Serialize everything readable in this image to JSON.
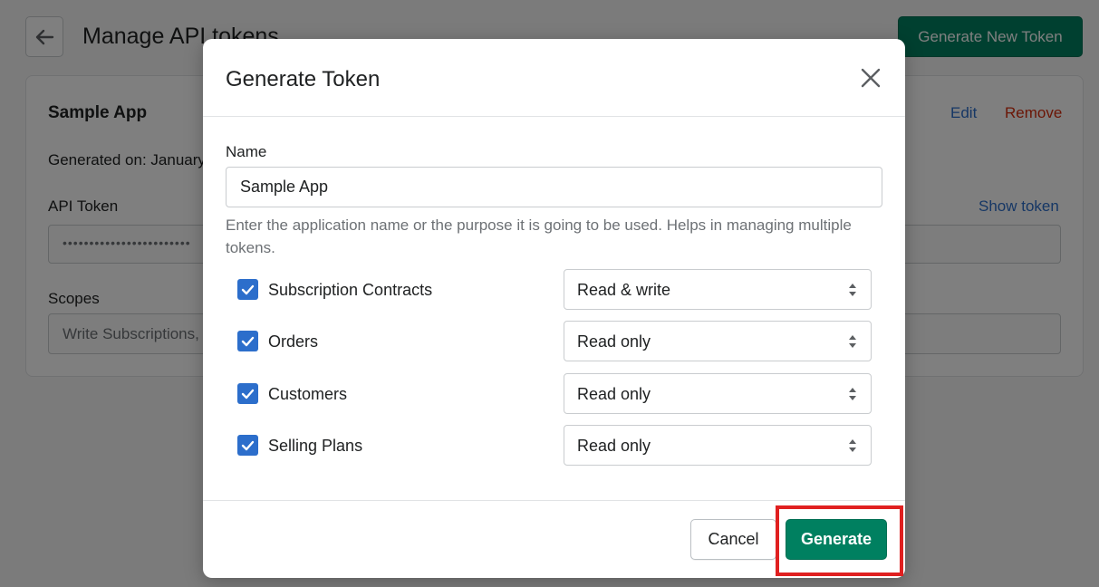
{
  "page": {
    "title": "Manage API tokens",
    "generate_new_label": "Generate New Token"
  },
  "card": {
    "app_name": "Sample App",
    "edit_label": "Edit",
    "remove_label": "Remove",
    "generated_on": "Generated on: January",
    "token_label": "API Token",
    "show_token_label": "Show token",
    "token_masked": "••••••••••••••••••••••••",
    "scopes_label": "Scopes",
    "scopes_value": "Write Subscriptions,"
  },
  "modal": {
    "title": "Generate Token",
    "name_label": "Name",
    "name_value": "Sample App",
    "help_text": "Enter the application name or the purpose it is going to be used. Helps in managing multiple tokens.",
    "scopes": [
      {
        "label": "Subscription Contracts",
        "checked": true,
        "access": "Read & write"
      },
      {
        "label": "Orders",
        "checked": true,
        "access": "Read only"
      },
      {
        "label": "Customers",
        "checked": true,
        "access": "Read only"
      },
      {
        "label": "Selling Plans",
        "checked": true,
        "access": "Read only"
      }
    ],
    "cancel_label": "Cancel",
    "generate_label": "Generate"
  },
  "colors": {
    "primary": "#008060",
    "checkbox": "#2c6ecb",
    "link": "#2c6ecb",
    "danger": "#d72c0d",
    "highlight": "#e02020"
  }
}
